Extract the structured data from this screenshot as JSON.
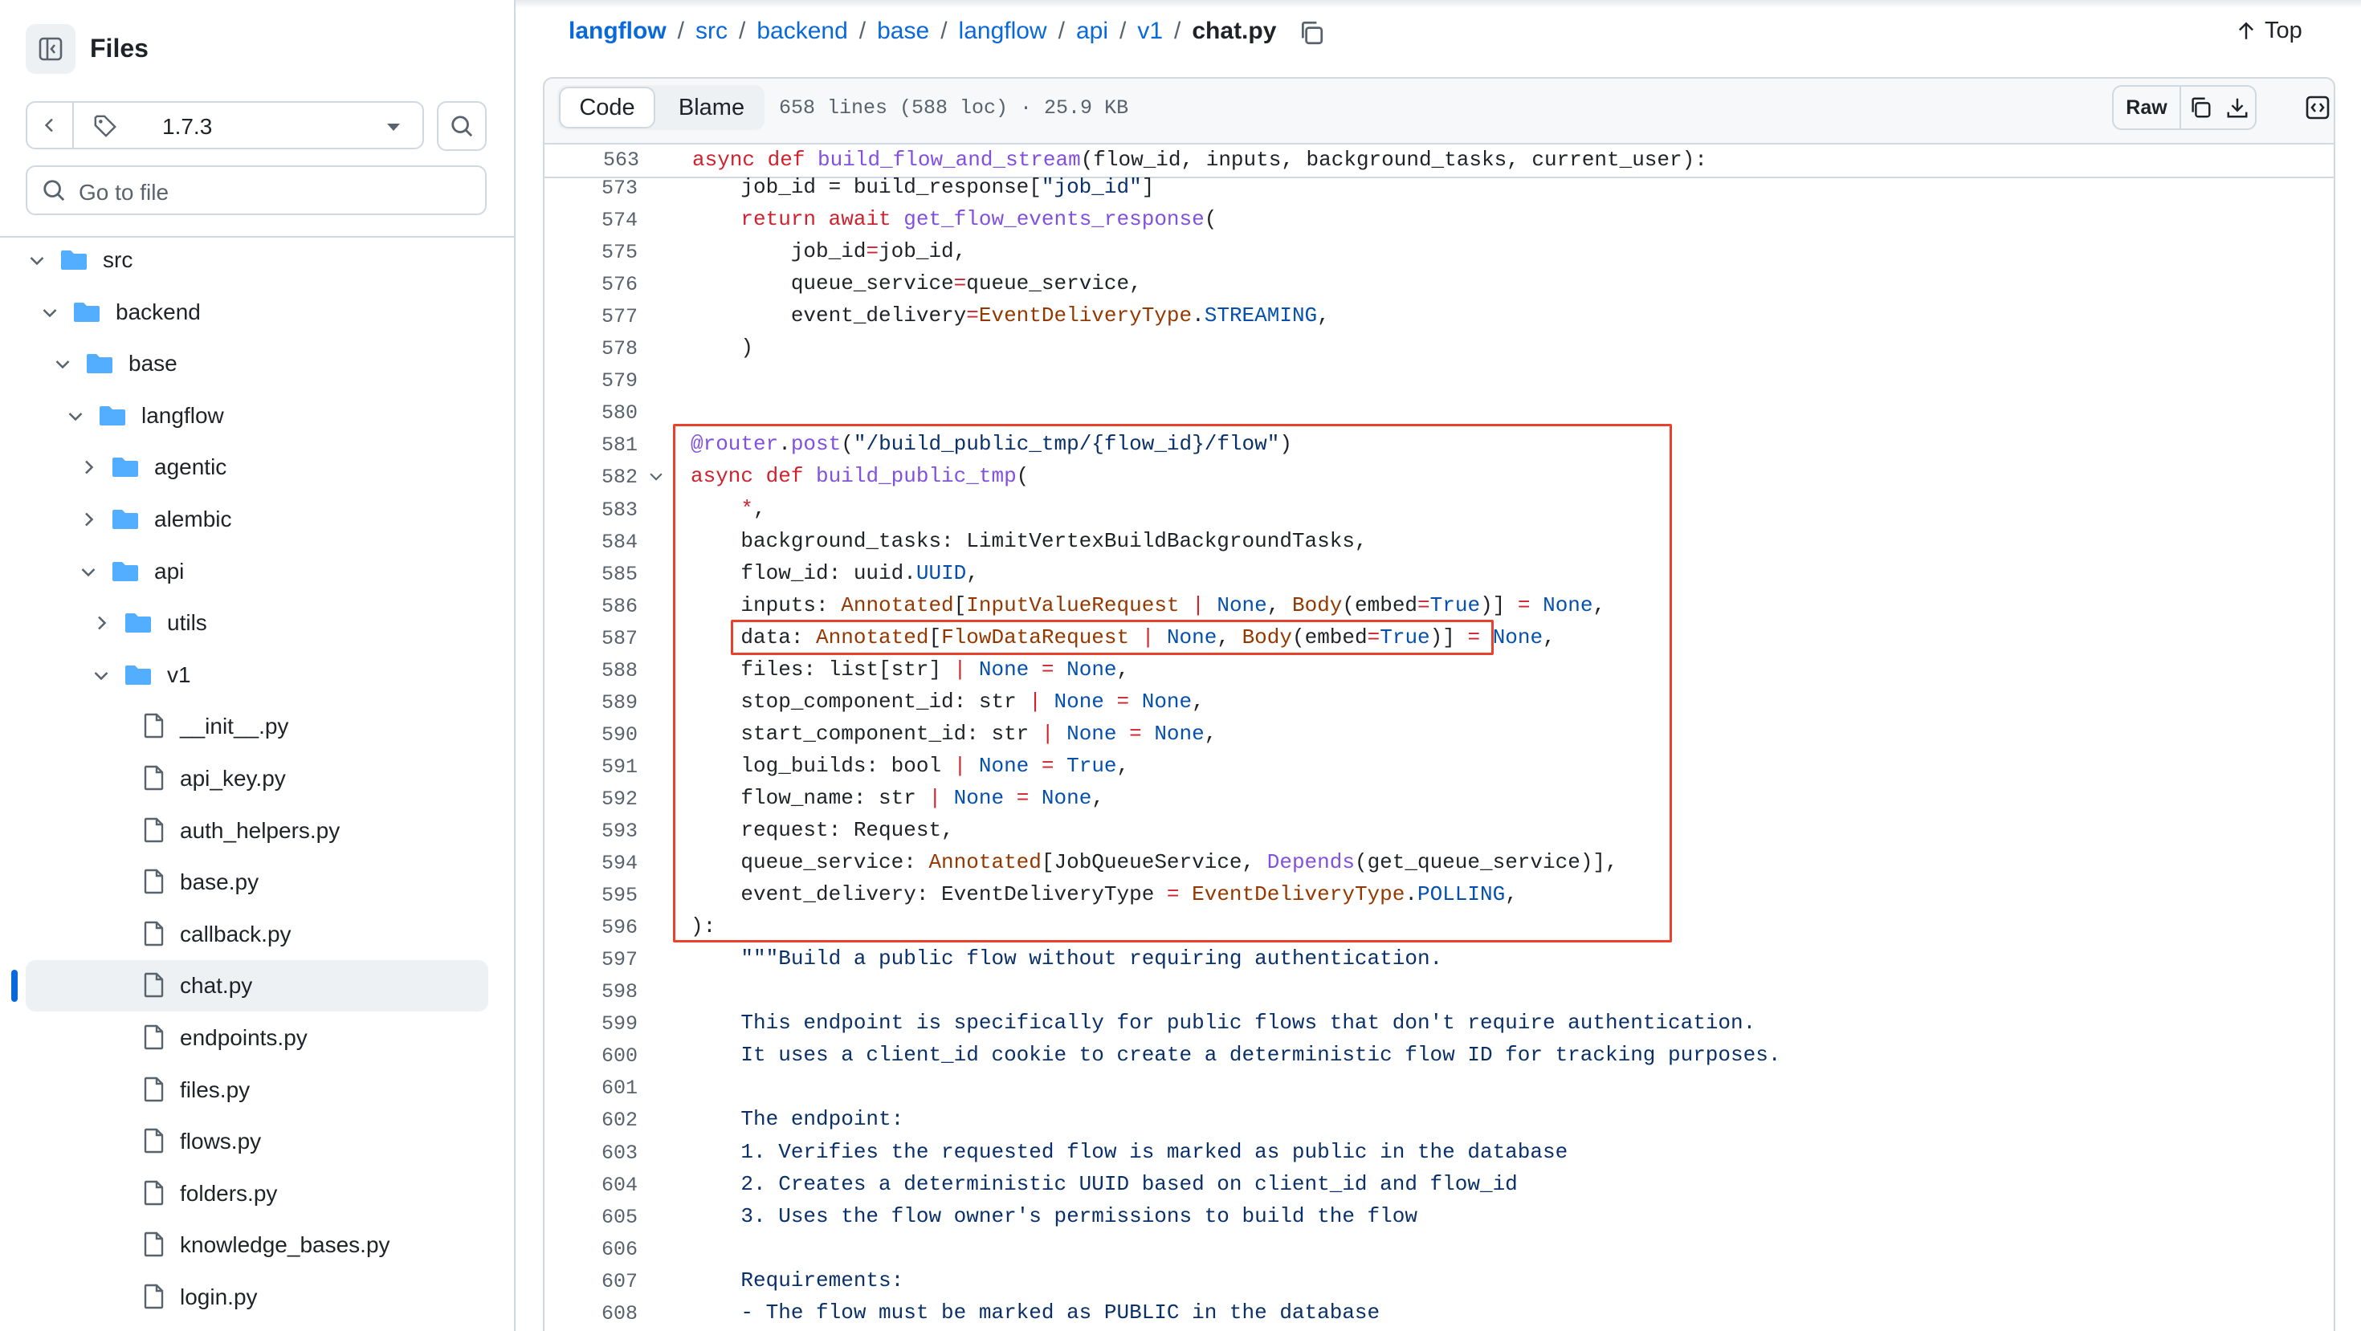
{
  "sidebar": {
    "title": "Files",
    "branch": "1.7.3",
    "go_to_file_placeholder": "Go to file",
    "tree": [
      {
        "name": "src",
        "depth": 0,
        "type": "folder",
        "expanded": true
      },
      {
        "name": "backend",
        "depth": 1,
        "type": "folder",
        "expanded": true
      },
      {
        "name": "base",
        "depth": 2,
        "type": "folder",
        "expanded": true
      },
      {
        "name": "langflow",
        "depth": 3,
        "type": "folder",
        "expanded": true
      },
      {
        "name": "agentic",
        "depth": 4,
        "type": "folder",
        "expanded": false
      },
      {
        "name": "alembic",
        "depth": 4,
        "type": "folder",
        "expanded": false
      },
      {
        "name": "api",
        "depth": 4,
        "type": "folder",
        "expanded": true
      },
      {
        "name": "utils",
        "depth": 5,
        "type": "folder",
        "expanded": false
      },
      {
        "name": "v1",
        "depth": 5,
        "type": "folder",
        "expanded": true
      },
      {
        "name": "__init__.py",
        "depth": 6,
        "type": "file"
      },
      {
        "name": "api_key.py",
        "depth": 6,
        "type": "file"
      },
      {
        "name": "auth_helpers.py",
        "depth": 6,
        "type": "file"
      },
      {
        "name": "base.py",
        "depth": 6,
        "type": "file"
      },
      {
        "name": "callback.py",
        "depth": 6,
        "type": "file"
      },
      {
        "name": "chat.py",
        "depth": 6,
        "type": "file",
        "selected": true
      },
      {
        "name": "endpoints.py",
        "depth": 6,
        "type": "file"
      },
      {
        "name": "files.py",
        "depth": 6,
        "type": "file"
      },
      {
        "name": "flows.py",
        "depth": 6,
        "type": "file"
      },
      {
        "name": "folders.py",
        "depth": 6,
        "type": "file"
      },
      {
        "name": "knowledge_bases.py",
        "depth": 6,
        "type": "file"
      },
      {
        "name": "login.py",
        "depth": 6,
        "type": "file"
      }
    ]
  },
  "breadcrumb": {
    "parts": [
      "langflow",
      "src",
      "backend",
      "base",
      "langflow",
      "api",
      "v1"
    ],
    "separator": "/",
    "current": "chat.py"
  },
  "top_label": "Top",
  "file_header": {
    "tabs": [
      "Code",
      "Blame"
    ],
    "info": "658 lines (588 loc) · 25.9 KB",
    "raw_label": "Raw"
  },
  "code": {
    "sticky": {
      "num": "563",
      "tokens": [
        [
          "kw",
          "async def "
        ],
        [
          "fn",
          "build_flow_and_stream"
        ],
        [
          "pl",
          "(flow_id, inputs, background_tasks, current_user):"
        ]
      ]
    },
    "lines": [
      {
        "num": "573",
        "tokens": [
          [
            "pl",
            "    job_id = build_response["
          ],
          [
            "str",
            "\"job_id\""
          ],
          [
            "pl",
            "]"
          ]
        ]
      },
      {
        "num": "574",
        "tokens": [
          [
            "pl",
            "    "
          ],
          [
            "kw",
            "return await "
          ],
          [
            "fn",
            "get_flow_events_response"
          ],
          [
            "pl",
            "("
          ]
        ]
      },
      {
        "num": "575",
        "tokens": [
          [
            "pl",
            "        job_id"
          ],
          [
            "kw",
            "="
          ],
          [
            "pl",
            "job_id,"
          ]
        ]
      },
      {
        "num": "576",
        "tokens": [
          [
            "pl",
            "        queue_service"
          ],
          [
            "kw",
            "="
          ],
          [
            "pl",
            "queue_service,"
          ]
        ]
      },
      {
        "num": "577",
        "tokens": [
          [
            "pl",
            "        event_delivery"
          ],
          [
            "kw",
            "="
          ],
          [
            "ty",
            "EventDeliveryType"
          ],
          [
            "pl",
            "."
          ],
          [
            "cn",
            "STREAMING"
          ],
          [
            "pl",
            ","
          ]
        ]
      },
      {
        "num": "578",
        "tokens": [
          [
            "pl",
            "    )"
          ]
        ]
      },
      {
        "num": "579",
        "tokens": []
      },
      {
        "num": "580",
        "tokens": []
      },
      {
        "num": "581",
        "tokens": [
          [
            "fn",
            "@router"
          ],
          [
            "pl",
            "."
          ],
          [
            "fn",
            "post"
          ],
          [
            "pl",
            "("
          ],
          [
            "str",
            "\"/build_public_tmp/{flow_id}/flow\""
          ],
          [
            "pl",
            ")"
          ]
        ]
      },
      {
        "num": "582",
        "tokens": [
          [
            "kw",
            "async def "
          ],
          [
            "fn",
            "build_public_tmp"
          ],
          [
            "pl",
            "("
          ]
        ]
      },
      {
        "num": "583",
        "tokens": [
          [
            "pl",
            "    "
          ],
          [
            "kw",
            "*"
          ],
          [
            "pl",
            ","
          ]
        ]
      },
      {
        "num": "584",
        "tokens": [
          [
            "pl",
            "    background_tasks: LimitVertexBuildBackgroundTasks,"
          ]
        ]
      },
      {
        "num": "585",
        "tokens": [
          [
            "pl",
            "    flow_id: uuid."
          ],
          [
            "cn",
            "UUID"
          ],
          [
            "pl",
            ","
          ]
        ]
      },
      {
        "num": "586",
        "tokens": [
          [
            "pl",
            "    inputs: "
          ],
          [
            "ty",
            "Annotated"
          ],
          [
            "pl",
            "["
          ],
          [
            "ty",
            "InputValueRequest"
          ],
          [
            "kw",
            " | "
          ],
          [
            "cn",
            "None"
          ],
          [
            "pl",
            ", "
          ],
          [
            "ty",
            "Body"
          ],
          [
            "pl",
            "(embed"
          ],
          [
            "kw",
            "="
          ],
          [
            "cn",
            "True"
          ],
          [
            "pl",
            ")]"
          ],
          [
            "kw",
            " = "
          ],
          [
            "cn",
            "None"
          ],
          [
            "pl",
            ","
          ]
        ]
      },
      {
        "num": "587",
        "tokens": [
          [
            "pl",
            "    data: "
          ],
          [
            "ty",
            "Annotated"
          ],
          [
            "pl",
            "["
          ],
          [
            "ty",
            "FlowDataRequest"
          ],
          [
            "kw",
            " | "
          ],
          [
            "cn",
            "None"
          ],
          [
            "pl",
            ", "
          ],
          [
            "ty",
            "Body"
          ],
          [
            "pl",
            "(embed"
          ],
          [
            "kw",
            "="
          ],
          [
            "cn",
            "True"
          ],
          [
            "pl",
            ")]"
          ],
          [
            "kw",
            " = "
          ],
          [
            "cn",
            "None"
          ],
          [
            "pl",
            ","
          ]
        ]
      },
      {
        "num": "588",
        "tokens": [
          [
            "pl",
            "    files: list[str]"
          ],
          [
            "kw",
            " | "
          ],
          [
            "cn",
            "None"
          ],
          [
            "kw",
            " = "
          ],
          [
            "cn",
            "None"
          ],
          [
            "pl",
            ","
          ]
        ]
      },
      {
        "num": "589",
        "tokens": [
          [
            "pl",
            "    stop_component_id: str"
          ],
          [
            "kw",
            " | "
          ],
          [
            "cn",
            "None"
          ],
          [
            "kw",
            " = "
          ],
          [
            "cn",
            "None"
          ],
          [
            "pl",
            ","
          ]
        ]
      },
      {
        "num": "590",
        "tokens": [
          [
            "pl",
            "    start_component_id: str"
          ],
          [
            "kw",
            " | "
          ],
          [
            "cn",
            "None"
          ],
          [
            "kw",
            " = "
          ],
          [
            "cn",
            "None"
          ],
          [
            "pl",
            ","
          ]
        ]
      },
      {
        "num": "591",
        "tokens": [
          [
            "pl",
            "    log_builds: bool"
          ],
          [
            "kw",
            " | "
          ],
          [
            "cn",
            "None"
          ],
          [
            "kw",
            " = "
          ],
          [
            "cn",
            "True"
          ],
          [
            "pl",
            ","
          ]
        ]
      },
      {
        "num": "592",
        "tokens": [
          [
            "pl",
            "    flow_name: str"
          ],
          [
            "kw",
            " | "
          ],
          [
            "cn",
            "None"
          ],
          [
            "kw",
            " = "
          ],
          [
            "cn",
            "None"
          ],
          [
            "pl",
            ","
          ]
        ]
      },
      {
        "num": "593",
        "tokens": [
          [
            "pl",
            "    request: Request,"
          ]
        ]
      },
      {
        "num": "594",
        "tokens": [
          [
            "pl",
            "    queue_service: "
          ],
          [
            "ty",
            "Annotated"
          ],
          [
            "pl",
            "[JobQueueService, "
          ],
          [
            "fn",
            "Depends"
          ],
          [
            "pl",
            "(get_queue_service)],"
          ]
        ]
      },
      {
        "num": "595",
        "tokens": [
          [
            "pl",
            "    event_delivery: EventDeliveryType"
          ],
          [
            "kw",
            " = "
          ],
          [
            "ty",
            "EventDeliveryType"
          ],
          [
            "pl",
            "."
          ],
          [
            "cn",
            "POLLING"
          ],
          [
            "pl",
            ","
          ]
        ]
      },
      {
        "num": "596",
        "tokens": [
          [
            "pl",
            "):"
          ]
        ]
      },
      {
        "num": "597",
        "tokens": [
          [
            "str",
            "    \"\"\"Build a public flow without requiring authentication."
          ]
        ]
      },
      {
        "num": "598",
        "tokens": []
      },
      {
        "num": "599",
        "tokens": [
          [
            "str",
            "    This endpoint is specifically for public flows that don't require authentication."
          ]
        ]
      },
      {
        "num": "600",
        "tokens": [
          [
            "str",
            "    It uses a client_id cookie to create a deterministic flow ID for tracking purposes."
          ]
        ]
      },
      {
        "num": "601",
        "tokens": []
      },
      {
        "num": "602",
        "tokens": [
          [
            "str",
            "    The endpoint:"
          ]
        ]
      },
      {
        "num": "603",
        "tokens": [
          [
            "str",
            "    1. Verifies the requested flow is marked as public in the database"
          ]
        ]
      },
      {
        "num": "604",
        "tokens": [
          [
            "str",
            "    2. Creates a deterministic UUID based on client_id and flow_id"
          ]
        ]
      },
      {
        "num": "605",
        "tokens": [
          [
            "str",
            "    3. Uses the flow owner's permissions to build the flow"
          ]
        ]
      },
      {
        "num": "606",
        "tokens": []
      },
      {
        "num": "607",
        "tokens": [
          [
            "str",
            "    Requirements:"
          ]
        ]
      },
      {
        "num": "608",
        "tokens": [
          [
            "str",
            "    - The flow must be marked as PUBLIC in the database"
          ]
        ]
      }
    ]
  },
  "colors": {
    "accent": "#0969da",
    "highlight_box": "#e8422c",
    "keyword": "#cf222e",
    "function": "#8250df",
    "string": "#0a3069",
    "constant": "#0550ae",
    "type": "#953800"
  }
}
